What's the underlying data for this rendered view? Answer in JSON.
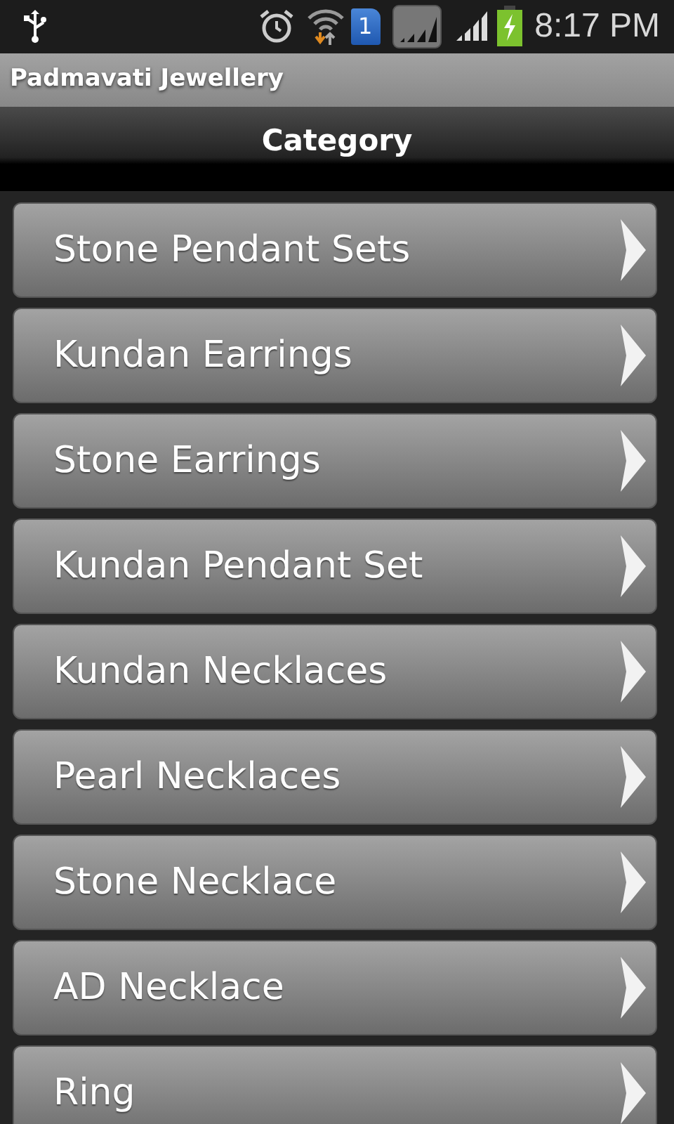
{
  "status_bar": {
    "sim_label": "1",
    "time": "8:17 PM"
  },
  "app_title": "Padmavati Jewellery",
  "header": {
    "title": "Category"
  },
  "categories": [
    {
      "label": "Stone Pendant Sets"
    },
    {
      "label": "Kundan Earrings"
    },
    {
      "label": "Stone Earrings"
    },
    {
      "label": "Kundan Pendant Set"
    },
    {
      "label": "Kundan Necklaces"
    },
    {
      "label": "Pearl Necklaces"
    },
    {
      "label": "Stone Necklace"
    },
    {
      "label": "AD Necklace"
    },
    {
      "label": "Ring"
    }
  ]
}
